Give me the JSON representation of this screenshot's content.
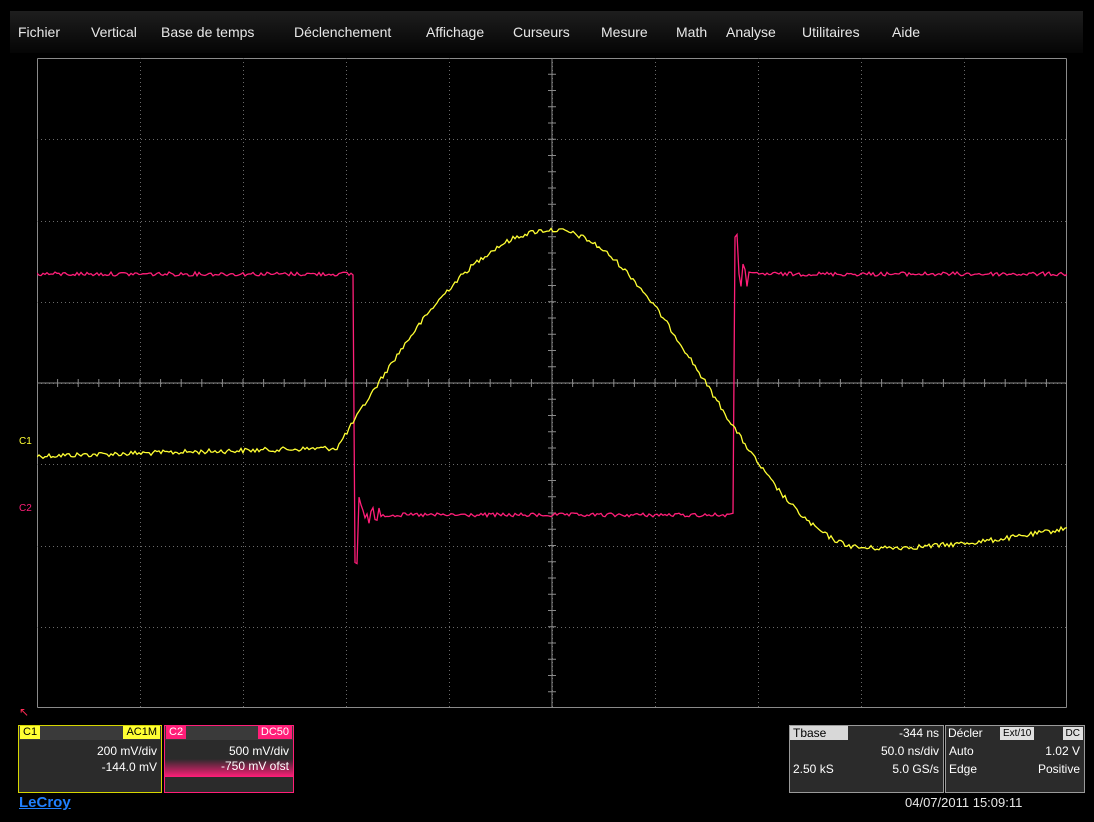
{
  "menu": [
    "Fichier",
    "Vertical",
    "Base de temps",
    "Déclenchement",
    "Affichage",
    "Curseurs",
    "Mesure",
    "Math",
    "Analyse",
    "Utilitaires",
    "Aide"
  ],
  "channels": {
    "c1": {
      "label": "C1",
      "coupling": "AC1M",
      "scale": "200 mV/div",
      "offset": "-144.0 mV",
      "color": "#ffff33"
    },
    "c2": {
      "label": "C2",
      "coupling": "DC50",
      "scale": "500 mV/div",
      "offset": "-750 mV ofst",
      "color": "#ff1e78"
    }
  },
  "timebase": {
    "title": "Tbase",
    "delay": "-344 ns",
    "scale": "50.0 ns/div",
    "samples": "2.50 kS",
    "rate": "5.0 GS/s"
  },
  "trigger": {
    "title": "Décler",
    "source": "Ext/10",
    "coupling": "DC",
    "mode": "Auto",
    "level": "1.02 V",
    "type": "Edge",
    "slope": "Positive"
  },
  "brand": "LeCroy",
  "datetime": "04/07/2011 15:09:11",
  "colors": {
    "c1": "#ffff33",
    "c2": "#ff1e78",
    "grid": "#6a6a6a",
    "tbox_border": "#9a9a9a"
  }
}
